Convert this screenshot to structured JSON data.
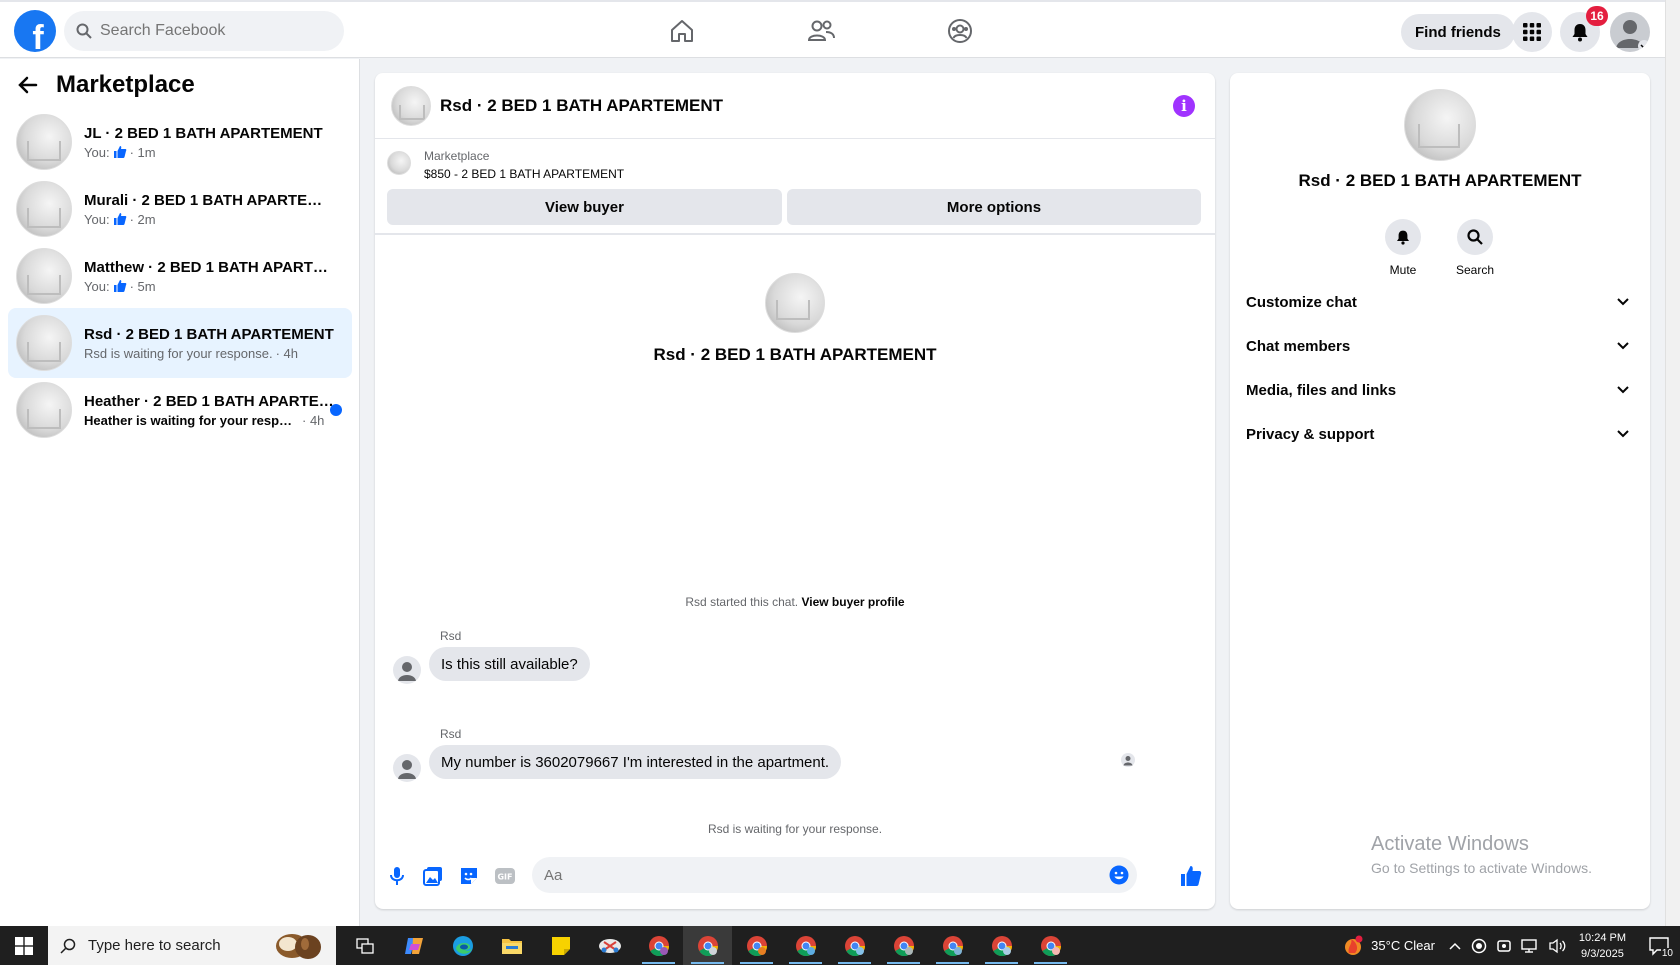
{
  "topnav": {
    "logo": "f",
    "search_placeholder": "Search Facebook",
    "find_friends": "Find friends",
    "notifications_count": "16"
  },
  "sidebar": {
    "title": "Marketplace",
    "conversations": [
      {
        "name": "JL · 2 BED 1 BATH APARTEMENT",
        "prefix": "You:",
        "time": "· 1m",
        "unread": false
      },
      {
        "name": "Murali · 2 BED 1 BATH APARTEMENT",
        "prefix": "You:",
        "time": "· 2m",
        "unread": false
      },
      {
        "name": "Matthew · 2 BED 1 BATH APARTEMENT",
        "prefix": "You:",
        "time": "· 5m",
        "unread": false
      },
      {
        "name": "Rsd · 2 BED 1 BATH APARTEMENT",
        "preview": "Rsd is waiting for your response.",
        "time": "· 4h",
        "active": true
      },
      {
        "name": "Heather · 2 BED 1 BATH APARTEMENT",
        "preview": "Heather is waiting for your response.",
        "time": "· 4h",
        "unread": true
      }
    ]
  },
  "chat": {
    "title": "Rsd · 2 BED 1 BATH APARTEMENT",
    "listing_label": "Marketplace",
    "listing_price": "$850 - 2 BED 1 BATH APARTEMENT",
    "view_buyer": "View buyer",
    "more_options": "More options",
    "intro_name": "Rsd · 2 BED 1 BATH APARTEMENT",
    "started_text": "Rsd started this chat.",
    "started_link": "View buyer profile",
    "messages": [
      {
        "sender": "Rsd",
        "text": "Is this still available?"
      },
      {
        "sender": "Rsd",
        "text": "My number is 3602079667 I'm interested in the apartment."
      }
    ],
    "waiting_text": "Rsd is waiting for your response.",
    "input_placeholder": "Aa",
    "gif_label": "GIF"
  },
  "details": {
    "name": "Rsd · 2 BED 1 BATH APARTEMENT",
    "mute": "Mute",
    "search": "Search",
    "sections": [
      "Customize chat",
      "Chat members",
      "Media, files and links",
      "Privacy & support"
    ]
  },
  "watermark": {
    "line1": "Activate Windows",
    "line2": "Go to Settings to activate Windows."
  },
  "taskbar": {
    "search_placeholder": "Type here to search",
    "weather": "35°C  Clear",
    "time": "10:24 PM",
    "date": "9/3/2025",
    "notification_count": "10"
  },
  "colors": {
    "brand": "#1877f2",
    "badge": "#e41e3f",
    "info": "#a033ff",
    "active_row": "#e7f3ff"
  }
}
